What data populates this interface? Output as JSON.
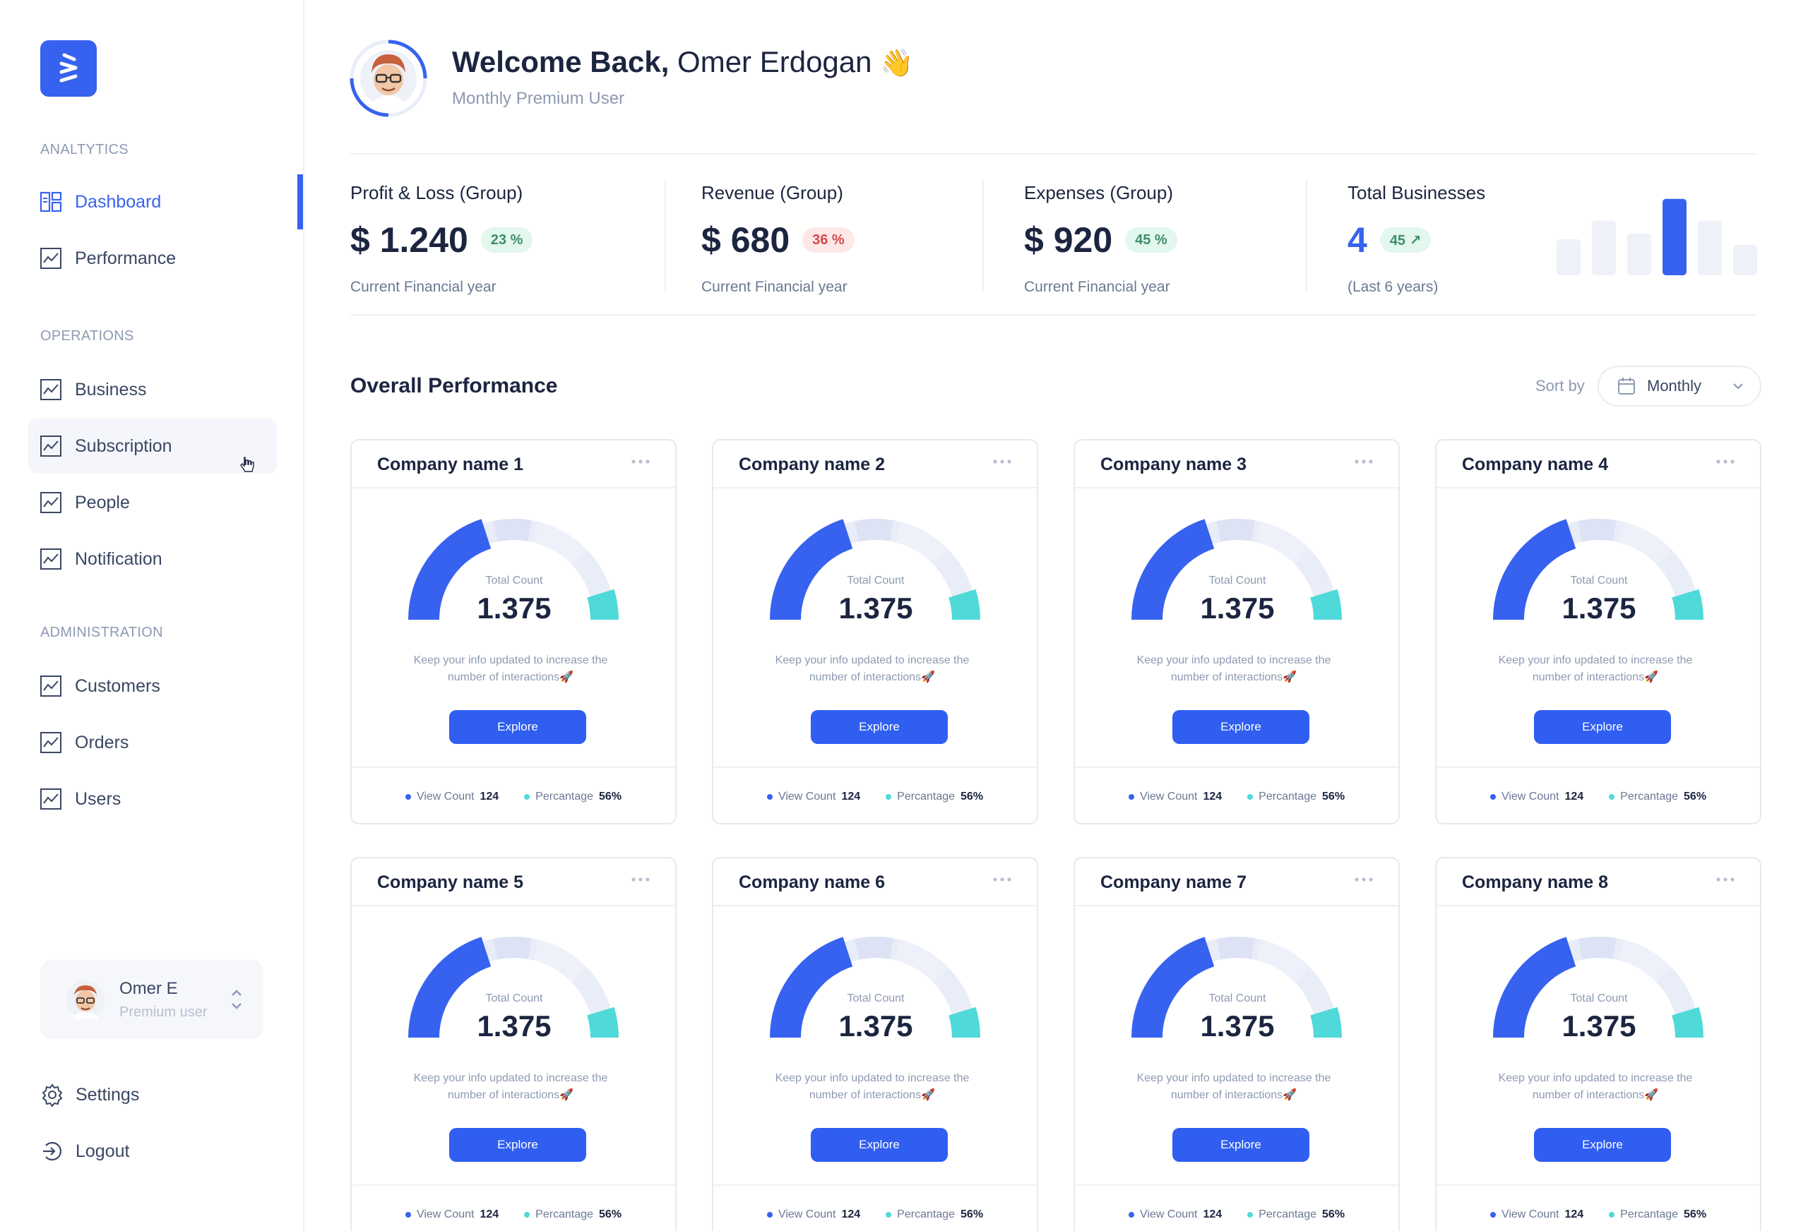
{
  "sidebar": {
    "sections": {
      "analytics": "ANALTYTICS",
      "operations": "OPERATIONS",
      "administration": "ADMINISTRATION"
    },
    "items": {
      "dashboard": "Dashboard",
      "performance": "Performance",
      "business": "Business",
      "subscription": "Subscription",
      "people": "People",
      "notification": "Notification",
      "customers": "Customers",
      "orders": "Orders",
      "users": "Users"
    },
    "active_item": "Dashboard",
    "user": {
      "name": "Omer E",
      "role": "Premium user"
    },
    "settings_label": "Settings",
    "logout_label": "Logout"
  },
  "header": {
    "welcome_bold": "Welcome Back,",
    "user_name": "Omer Erdogan",
    "wave": "👋",
    "subtitle": "Monthly Premium User"
  },
  "stats": [
    {
      "label": "Profit & Loss (Group)",
      "value": "$ 1.240",
      "badge": "23 %",
      "badge_color": "green",
      "sub": "Current Financial year"
    },
    {
      "label": "Revenue (Group)",
      "value": "$ 680",
      "badge": "36 %",
      "badge_color": "red",
      "sub": "Current Financial year"
    },
    {
      "label": "Expenses (Group)",
      "value": "$ 920",
      "badge": "45 %",
      "badge_color": "green",
      "sub": "Current Financial year"
    },
    {
      "label": "Total Businesses",
      "value": "4",
      "badge": "45 ↗",
      "badge_color": "green",
      "sub": "(Last 6 years)"
    }
  ],
  "mini_chart": {
    "values": [
      0.45,
      0.68,
      0.52,
      0.95,
      0.68,
      0.38
    ],
    "highlight_index": 3
  },
  "performance": {
    "title": "Overall Performance",
    "sort_label": "Sort by",
    "sort_value": "Monthly"
  },
  "cards": [
    {
      "name": "Company name 1"
    },
    {
      "name": "Company name 2"
    },
    {
      "name": "Company name 3"
    },
    {
      "name": "Company name 4"
    },
    {
      "name": "Company name 5"
    },
    {
      "name": "Company name 6"
    },
    {
      "name": "Company name 7"
    },
    {
      "name": "Company name 8"
    }
  ],
  "card_common": {
    "gauge_label": "Total Count",
    "gauge_value": "1.375",
    "note": "Keep your info updated to increase the number of interactions🚀",
    "explore_label": "Explore",
    "view_count_label": "View Count",
    "view_count_value": "124",
    "percentage_label": "Percantage",
    "percentage_value": "56%"
  },
  "colors": {
    "accent": "#3762f0",
    "teal": "#4fd9d9",
    "gauge_track": "#e9edf8",
    "badge_green_bg": "#e3f7ee",
    "badge_red_bg": "#fde8e8"
  }
}
